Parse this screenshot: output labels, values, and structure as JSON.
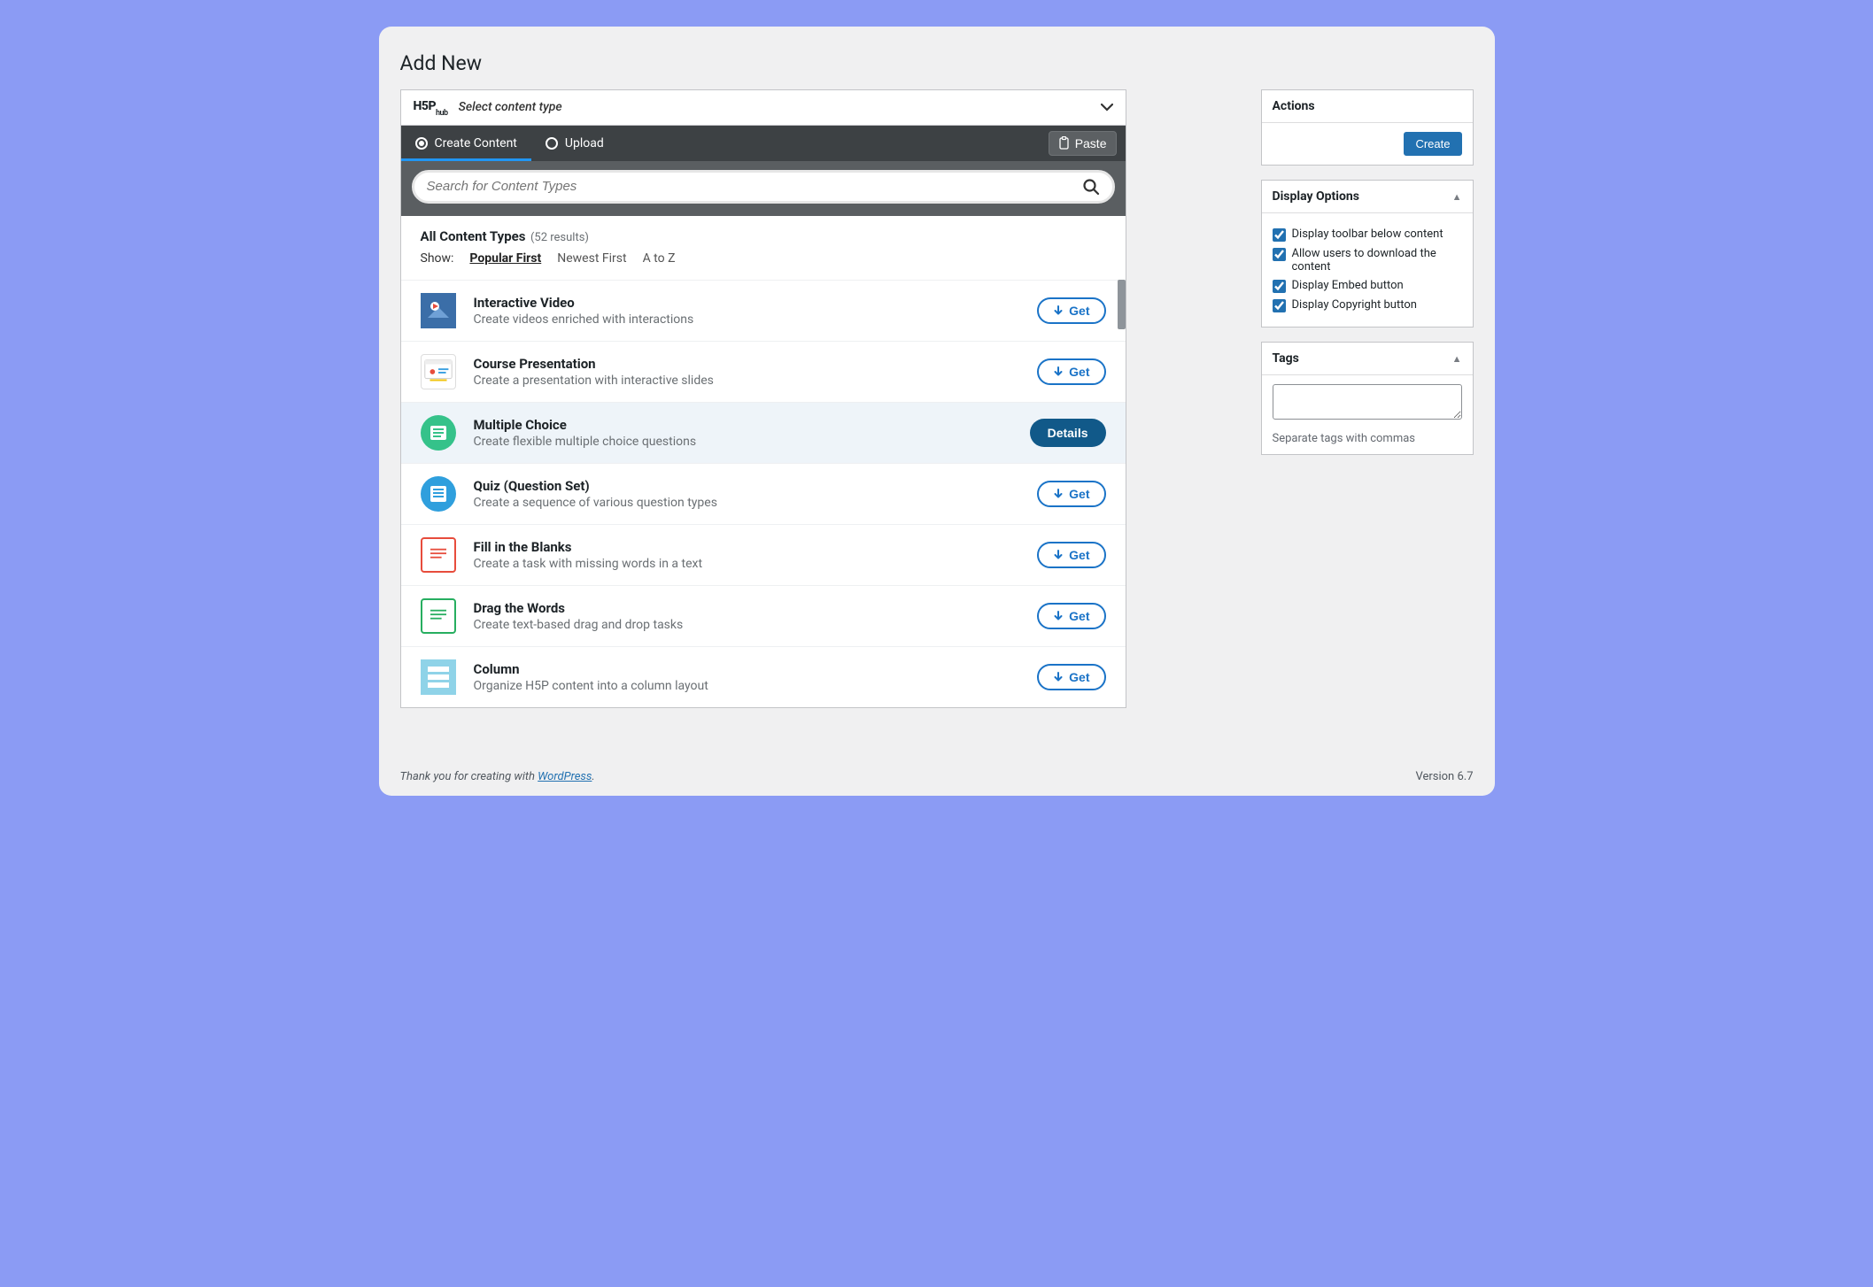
{
  "page": {
    "title": "Add New"
  },
  "hub": {
    "logo_main": "H5P",
    "logo_sub": "hub",
    "select_label": "Select content type",
    "tabs": {
      "create": "Create Content",
      "upload": "Upload"
    },
    "paste_label": "Paste",
    "search_placeholder": "Search for Content Types",
    "results_title": "All Content Types",
    "results_count": "(52 results)",
    "show_label": "Show:",
    "sort": {
      "popular": "Popular First",
      "newest": "Newest First",
      "az": "A to Z"
    },
    "get_label": "Get",
    "details_label": "Details",
    "items": [
      {
        "title": "Interactive Video",
        "desc": "Create videos enriched with interactions",
        "action": "get",
        "icon": "ic-video"
      },
      {
        "title": "Course Presentation",
        "desc": "Create a presentation with interactive slides",
        "action": "get",
        "icon": "ic-pres"
      },
      {
        "title": "Multiple Choice",
        "desc": "Create flexible multiple choice questions",
        "action": "details",
        "icon": "ic-mc",
        "selected": true
      },
      {
        "title": "Quiz (Question Set)",
        "desc": "Create a sequence of various question types",
        "action": "get",
        "icon": "ic-quiz"
      },
      {
        "title": "Fill in the Blanks",
        "desc": "Create a task with missing words in a text",
        "action": "get",
        "icon": "ic-fill"
      },
      {
        "title": "Drag the Words",
        "desc": "Create text-based drag and drop tasks",
        "action": "get",
        "icon": "ic-drag"
      },
      {
        "title": "Column",
        "desc": "Organize H5P content into a column layout",
        "action": "get",
        "icon": "ic-col"
      }
    ]
  },
  "sidebar": {
    "actions": {
      "title": "Actions",
      "create": "Create"
    },
    "display": {
      "title": "Display Options",
      "opts": [
        "Display toolbar below content",
        "Allow users to download the content",
        "Display Embed button",
        "Display Copyright button"
      ]
    },
    "tags": {
      "title": "Tags",
      "help": "Separate tags with commas"
    }
  },
  "footer": {
    "thanks_prefix": "Thank you for creating with ",
    "wp": "WordPress",
    "suffix": ".",
    "version": "Version 6.7"
  }
}
